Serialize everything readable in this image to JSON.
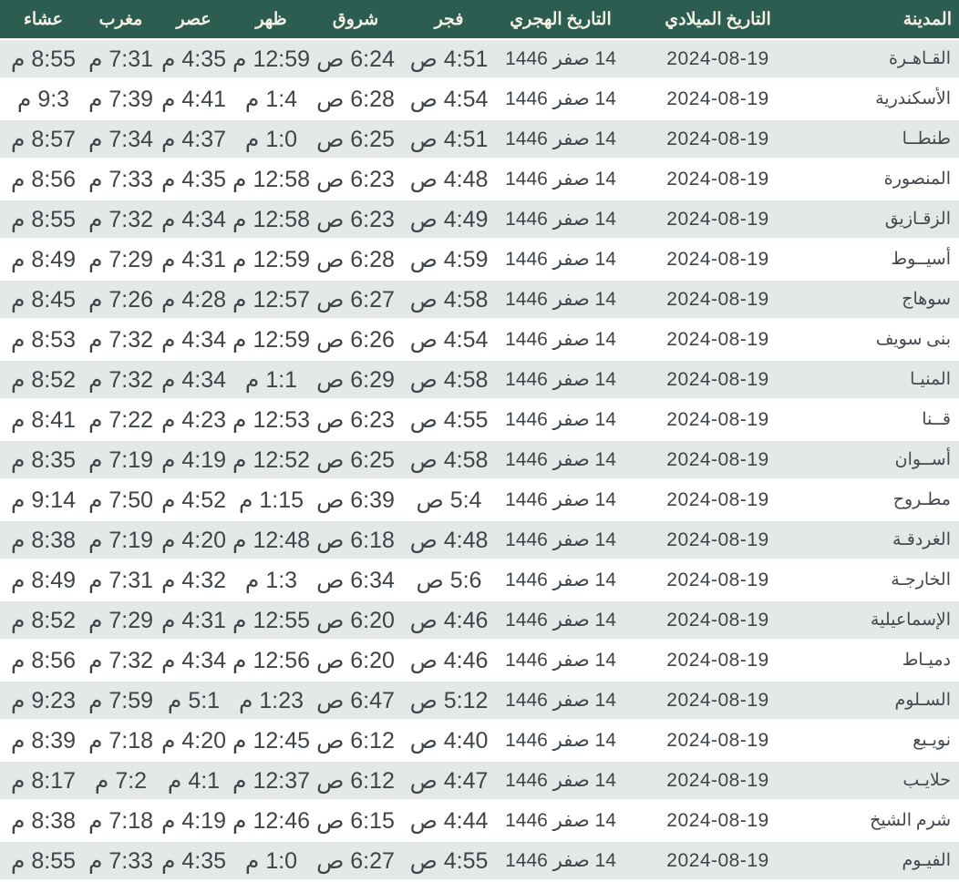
{
  "theme": {
    "header_bg": "#2d5d51",
    "header_text": "#f3efe4",
    "row_alt_bg": "#e4e9e8",
    "row_bg": "#ffffff",
    "cell_text": "#3f4449",
    "city_text": "#43484d",
    "separator": "#ffffff"
  },
  "table": {
    "columns": [
      {
        "key": "city",
        "label": "المدينة",
        "kind": "city"
      },
      {
        "key": "gregorian",
        "label": "التاريخ الميلادي",
        "kind": "date"
      },
      {
        "key": "hijri",
        "label": "التاريخ الهجري",
        "kind": "date"
      },
      {
        "key": "fajr",
        "label": "فجر",
        "kind": "time"
      },
      {
        "key": "shorouq",
        "label": "شروق",
        "kind": "time"
      },
      {
        "key": "dhuhr",
        "label": "ظهر",
        "kind": "time"
      },
      {
        "key": "asr",
        "label": "عصر",
        "kind": "time"
      },
      {
        "key": "maghrib",
        "label": "مغرب",
        "kind": "time"
      },
      {
        "key": "isha",
        "label": "عشاء",
        "kind": "time"
      }
    ],
    "rows": [
      {
        "city": "القـاهـرة",
        "gregorian": "2024-08-19",
        "hijri": "14 صفر 1446",
        "fajr": "4:51 ص",
        "shorouq": "6:24 ص",
        "dhuhr": "12:59 م",
        "asr": "4:35 م",
        "maghrib": "7:31 م",
        "isha": "8:55 م"
      },
      {
        "city": "الأسكندرية",
        "gregorian": "2024-08-19",
        "hijri": "14 صفر 1446",
        "fajr": "4:54 ص",
        "shorouq": "6:28 ص",
        "dhuhr": "1:4 م",
        "asr": "4:41 م",
        "maghrib": "7:39 م",
        "isha": "9:3 م"
      },
      {
        "city": "طنطــا",
        "gregorian": "2024-08-19",
        "hijri": "14 صفر 1446",
        "fajr": "4:51 ص",
        "shorouq": "6:25 ص",
        "dhuhr": "1:0 م",
        "asr": "4:37 م",
        "maghrib": "7:34 م",
        "isha": "8:57 م"
      },
      {
        "city": "المنصورة",
        "gregorian": "2024-08-19",
        "hijri": "14 صفر 1446",
        "fajr": "4:48 ص",
        "shorouq": "6:23 ص",
        "dhuhr": "12:58 م",
        "asr": "4:35 م",
        "maghrib": "7:33 م",
        "isha": "8:56 م"
      },
      {
        "city": "الزقـازيق",
        "gregorian": "2024-08-19",
        "hijri": "14 صفر 1446",
        "fajr": "4:49 ص",
        "shorouq": "6:23 ص",
        "dhuhr": "12:58 م",
        "asr": "4:34 م",
        "maghrib": "7:32 م",
        "isha": "8:55 م"
      },
      {
        "city": "أسيــوط",
        "gregorian": "2024-08-19",
        "hijri": "14 صفر 1446",
        "fajr": "4:59 ص",
        "shorouq": "6:28 ص",
        "dhuhr": "12:59 م",
        "asr": "4:31 م",
        "maghrib": "7:29 م",
        "isha": "8:49 م"
      },
      {
        "city": "سوهاج",
        "gregorian": "2024-08-19",
        "hijri": "14 صفر 1446",
        "fajr": "4:58 ص",
        "shorouq": "6:27 ص",
        "dhuhr": "12:57 م",
        "asr": "4:28 م",
        "maghrib": "7:26 م",
        "isha": "8:45 م"
      },
      {
        "city": "بنى سويف",
        "gregorian": "2024-08-19",
        "hijri": "14 صفر 1446",
        "fajr": "4:54 ص",
        "shorouq": "6:26 ص",
        "dhuhr": "12:59 م",
        "asr": "4:34 م",
        "maghrib": "7:32 م",
        "isha": "8:53 م"
      },
      {
        "city": "المنيـا",
        "gregorian": "2024-08-19",
        "hijri": "14 صفر 1446",
        "fajr": "4:58 ص",
        "shorouq": "6:29 ص",
        "dhuhr": "1:1 م",
        "asr": "4:34 م",
        "maghrib": "7:32 م",
        "isha": "8:52 م"
      },
      {
        "city": "قــنا",
        "gregorian": "2024-08-19",
        "hijri": "14 صفر 1446",
        "fajr": "4:55 ص",
        "shorouq": "6:23 ص",
        "dhuhr": "12:53 م",
        "asr": "4:23 م",
        "maghrib": "7:22 م",
        "isha": "8:41 م"
      },
      {
        "city": "أســوان",
        "gregorian": "2024-08-19",
        "hijri": "14 صفر 1446",
        "fajr": "4:58 ص",
        "shorouq": "6:25 ص",
        "dhuhr": "12:52 م",
        "asr": "4:19 م",
        "maghrib": "7:19 م",
        "isha": "8:35 م"
      },
      {
        "city": "مطـروح",
        "gregorian": "2024-08-19",
        "hijri": "14 صفر 1446",
        "fajr": "5:4 ص",
        "shorouq": "6:39 ص",
        "dhuhr": "1:15 م",
        "asr": "4:52 م",
        "maghrib": "7:50 م",
        "isha": "9:14 م"
      },
      {
        "city": "الغردقـة",
        "gregorian": "2024-08-19",
        "hijri": "14 صفر 1446",
        "fajr": "4:48 ص",
        "shorouq": "6:18 ص",
        "dhuhr": "12:48 م",
        "asr": "4:20 م",
        "maghrib": "7:19 م",
        "isha": "8:38 م"
      },
      {
        "city": "الخارجـة",
        "gregorian": "2024-08-19",
        "hijri": "14 صفر 1446",
        "fajr": "5:6 ص",
        "shorouq": "6:34 ص",
        "dhuhr": "1:3 م",
        "asr": "4:32 م",
        "maghrib": "7:31 م",
        "isha": "8:49 م"
      },
      {
        "city": "الإسماعيلية",
        "gregorian": "2024-08-19",
        "hijri": "14 صفر 1446",
        "fajr": "4:46 ص",
        "shorouq": "6:20 ص",
        "dhuhr": "12:55 م",
        "asr": "4:31 م",
        "maghrib": "7:29 م",
        "isha": "8:52 م"
      },
      {
        "city": "دميـاط",
        "gregorian": "2024-08-19",
        "hijri": "14 صفر 1446",
        "fajr": "4:46 ص",
        "shorouq": "6:20 ص",
        "dhuhr": "12:56 م",
        "asr": "4:34 م",
        "maghrib": "7:32 م",
        "isha": "8:56 م"
      },
      {
        "city": "السـلوم",
        "gregorian": "2024-08-19",
        "hijri": "14 صفر 1446",
        "fajr": "5:12 ص",
        "shorouq": "6:47 ص",
        "dhuhr": "1:23 م",
        "asr": "5:1 م",
        "maghrib": "7:59 م",
        "isha": "9:23 م"
      },
      {
        "city": "نويـبع",
        "gregorian": "2024-08-19",
        "hijri": "14 صفر 1446",
        "fajr": "4:40 ص",
        "shorouq": "6:12 ص",
        "dhuhr": "12:45 م",
        "asr": "4:20 م",
        "maghrib": "7:18 م",
        "isha": "8:39 م"
      },
      {
        "city": "حلايـب",
        "gregorian": "2024-08-19",
        "hijri": "14 صفر 1446",
        "fajr": "4:47 ص",
        "shorouq": "6:12 ص",
        "dhuhr": "12:37 م",
        "asr": "4:1 م",
        "maghrib": "7:2 م",
        "isha": "8:17 م"
      },
      {
        "city": "شرم الشيخ",
        "gregorian": "2024-08-19",
        "hijri": "14 صفر 1446",
        "fajr": "4:44 ص",
        "shorouq": "6:15 ص",
        "dhuhr": "12:46 م",
        "asr": "4:19 م",
        "maghrib": "7:18 م",
        "isha": "8:38 م"
      },
      {
        "city": "الفيـوم",
        "gregorian": "2024-08-19",
        "hijri": "14 صفر 1446",
        "fajr": "4:55 ص",
        "shorouq": "6:27 ص",
        "dhuhr": "1:0 م",
        "asr": "4:35 م",
        "maghrib": "7:33 م",
        "isha": "8:55 م"
      }
    ]
  }
}
